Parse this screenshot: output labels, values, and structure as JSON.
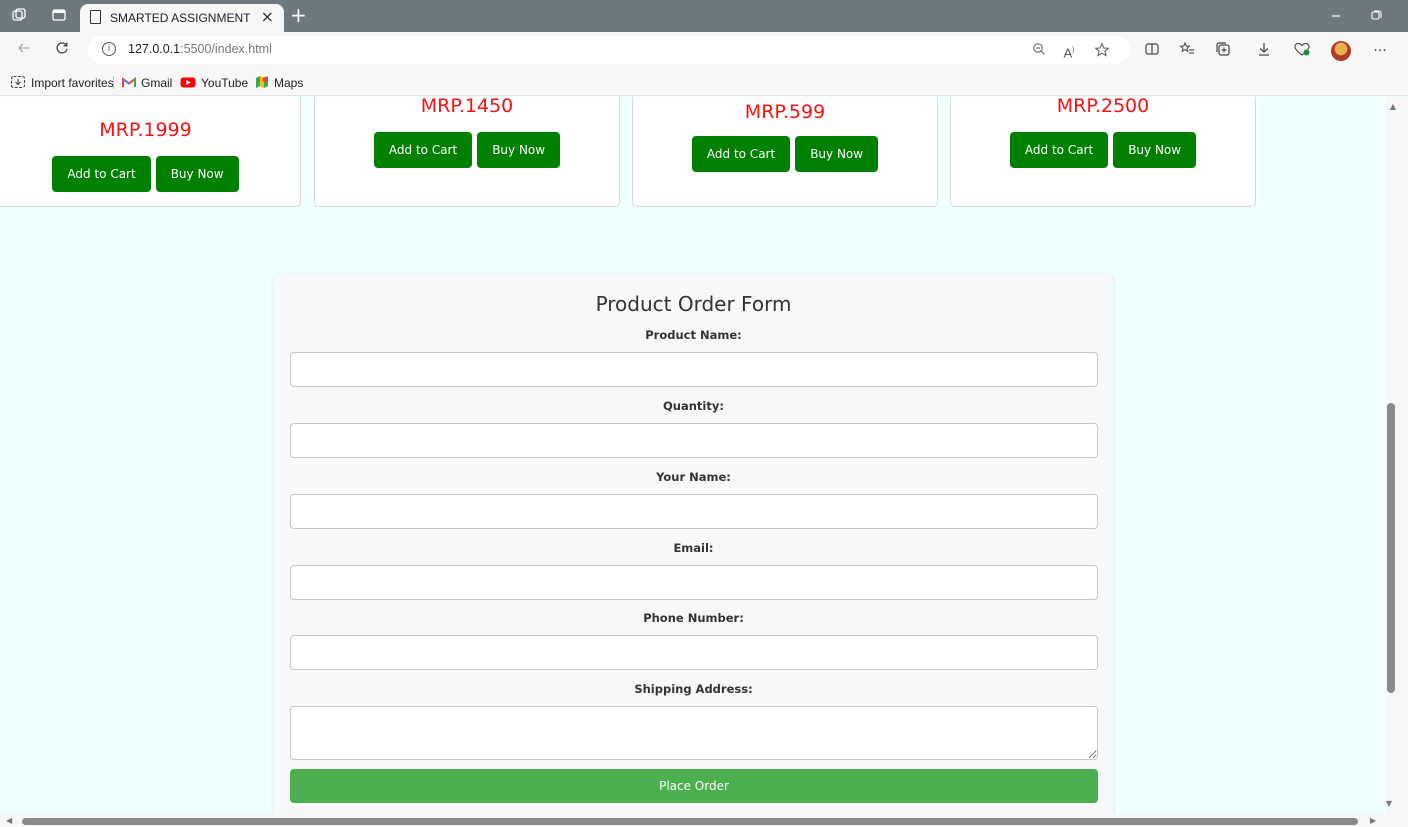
{
  "browser": {
    "tab_title": "SMARTED ASSIGNMENT",
    "tab_close": "×",
    "new_tab": "+",
    "url_host": "127.0.0.1",
    "url_rest": ":5500/index.html",
    "favorites": {
      "import": "Import favorites",
      "gmail": "Gmail",
      "youtube": "YouTube",
      "maps": "Maps"
    },
    "more_menu": "···"
  },
  "products": [
    {
      "price": "MRP.1999",
      "add_label": "Add to Cart",
      "buy_label": "Buy Now"
    },
    {
      "price": "MRP.1450",
      "add_label": "Add to Cart",
      "buy_label": "Buy Now"
    },
    {
      "price": "MRP.599",
      "add_label": "Add to Cart",
      "buy_label": "Buy Now"
    },
    {
      "price": "MRP.2500",
      "add_label": "Add to Cart",
      "buy_label": "Buy Now"
    }
  ],
  "form": {
    "title": "Product Order Form",
    "fields": [
      {
        "label": "Product Name:",
        "value": ""
      },
      {
        "label": "Quantity:",
        "value": ""
      },
      {
        "label": "Your Name:",
        "value": ""
      },
      {
        "label": "Email:",
        "value": ""
      },
      {
        "label": "Phone Number:",
        "value": ""
      },
      {
        "label": "Shipping Address:",
        "value": ""
      }
    ],
    "submit_label": "Place Order"
  },
  "colors": {
    "page_bg": "#f0ffff",
    "price": "#ff1010",
    "card_button": "#008000",
    "submit_button": "#4caf50"
  }
}
